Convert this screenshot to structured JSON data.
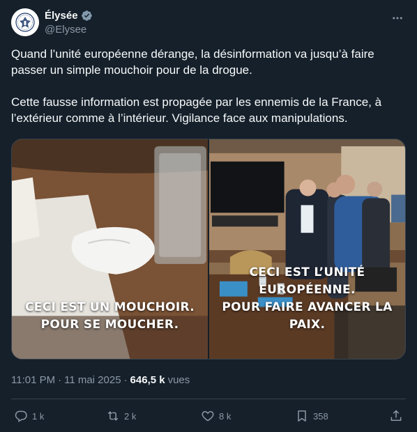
{
  "author": {
    "display_name": "Élysée",
    "handle": "@Elysee",
    "verified_color": "#829aab"
  },
  "tweet": {
    "paragraph_1": "Quand l’unité européenne dérange, la désinformation va jusqu’à faire passer un simple mouchoir pour de la drogue.",
    "paragraph_2": "Cette fausse information est propagée par les ennemis de la France, à l’extérieur comme à l’intérieur. Vigilance face aux manipulations."
  },
  "media": {
    "left_caption_line_1": "CECI EST UN MOUCHOIR.",
    "left_caption_line_2": "POUR SE MOUCHER.",
    "right_caption_line_1": "CECI EST L’UNITÉ EUROPÉENNE.",
    "right_caption_line_2": "POUR FAIRE AVANCER LA PAIX."
  },
  "meta": {
    "time": "11:01 PM",
    "separator_1": "·",
    "date": "11 mai 2025",
    "separator_2": "·",
    "views_count": "646,5 k",
    "views_label": "vues"
  },
  "actions": {
    "replies": "1 k",
    "reposts": "2 k",
    "likes": "8 k",
    "bookmarks": "358"
  },
  "colors": {
    "background": "#15202b",
    "text": "#f7f9f9",
    "secondary": "#8b98a5",
    "border": "#38444d"
  }
}
